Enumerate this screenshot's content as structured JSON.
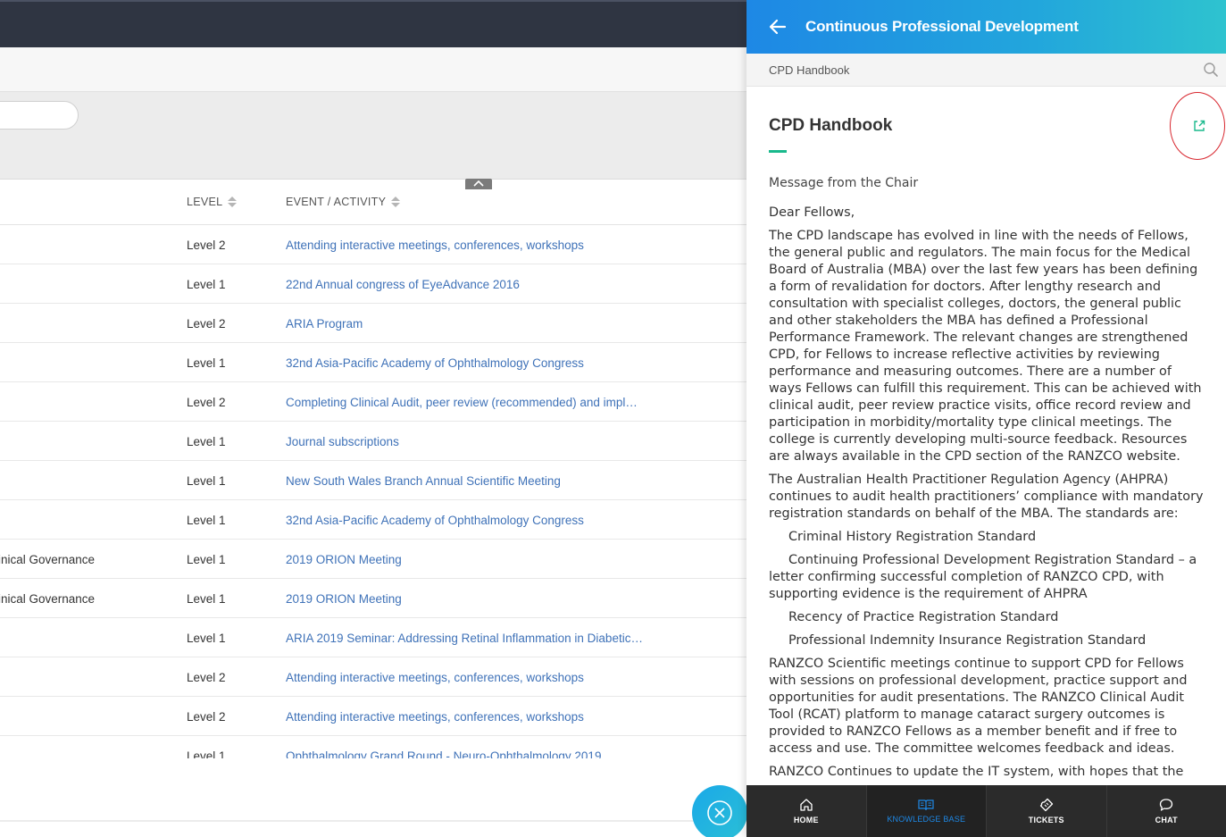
{
  "panel": {
    "title": "Continuous Professional Development",
    "breadcrumb": "CPD Handbook",
    "article_title": "CPD Handbook",
    "intro": "Message from the Chair",
    "salutation": "Dear Fellows,",
    "p1": "The CPD landscape has evolved in line with the needs of Fellows, the general public and regulators. The main focus for the Medical Board of Australia (MBA) over the last few years has been defining a form of revalidation for doctors. After lengthy research and consultation with specialist colleges, doctors, the general public and other stakeholders the MBA has defined a Professional Performance Framework. The relevant changes are strengthened CPD, for Fellows to increase reflective activities by reviewing performance and measuring outcomes. There are a number of ways Fellows can fulfill this requirement. This can be achieved with clinical audit, peer review practice visits, office record review and participation in morbidity/mortality type clinical meetings. The college is currently developing multi-source feedback. Resources are always available in the CPD section of the RANZCO website.",
    "p2": "The Australian Health Practitioner Regulation Agency (AHPRA) continues to audit health practitioners’ compliance with mandatory registration standards on behalf of the MBA. The standards are:",
    "s1": "Criminal History Registration Standard",
    "s2": "Continuing Professional Development Registration Standard – a letter confirming successful completion of RANZCO CPD, with supporting evidence is the requirement of AHPRA",
    "s3": "Recency of Practice Registration Standard",
    "s4": "Professional Indemnity Insurance Registration Standard",
    "p3": "RANZCO Scientific meetings continue to support CPD for Fellows with sessions on professional development, practice support and opportunities for audit presentations. The RANZCO Clinical Audit Tool (RCAT) platform to manage cataract surgery outcomes is provided to RANZCO Fellows as a member benefit and if free to access and use. The committee welcomes feedback and ideas.",
    "p4": "RANZCO Continues to update the IT system, with hopes that the",
    "accent_color": "#19b98c",
    "header_gradient": [
      "#1e88e5",
      "#2ec3cf"
    ]
  },
  "nav": {
    "home": "HOME",
    "kb": "KNOWLEDGE BASE",
    "tickets": "TICKETS",
    "chat": "CHAT"
  },
  "table": {
    "headers": {
      "level": "LEVEL",
      "event": "EVENT / ACTIVITY"
    },
    "rows": [
      {
        "category": "",
        "level": "Level 2",
        "event": "Attending interactive meetings, conferences, workshops"
      },
      {
        "category": "",
        "level": "Level 1",
        "event": "22nd Annual congress of EyeAdvance 2016"
      },
      {
        "category": "",
        "level": "Level 2",
        "event": "ARIA Program"
      },
      {
        "category": "",
        "level": "Level 1",
        "event": "32nd Asia-Pacific Academy of Ophthalmology Congress"
      },
      {
        "category": "",
        "level": "Level 2",
        "event": "Completing Clinical Audit, peer review (recommended) and implem..."
      },
      {
        "category": "",
        "level": "Level 1",
        "event": "Journal subscriptions"
      },
      {
        "category": "",
        "level": "Level 1",
        "event": "New South Wales Branch Annual Scientific Meeting"
      },
      {
        "category": "",
        "level": "Level 1",
        "event": "32nd Asia-Pacific Academy of Ophthalmology Congress"
      },
      {
        "category": "inical Governance",
        "level": "Level 1",
        "event": "2019 ORION Meeting"
      },
      {
        "category": "inical Governance",
        "level": "Level 1",
        "event": "2019 ORION Meeting"
      },
      {
        "category": "",
        "level": "Level 1",
        "event": "ARIA 2019 Seminar: Addressing Retinal Inflammation in Diabetic M..."
      },
      {
        "category": "",
        "level": "Level 2",
        "event": "Attending interactive meetings, conferences, workshops"
      },
      {
        "category": "",
        "level": "Level 2",
        "event": "Attending interactive meetings, conferences, workshops"
      },
      {
        "category": "",
        "level": "Level 1",
        "event": "Ophthalmology Grand Round - Neuro-Ophthalmology 2019"
      }
    ]
  },
  "colors": {
    "link": "#3f72b8",
    "topbar": "#2f3542",
    "annotation": "#d8262e"
  }
}
